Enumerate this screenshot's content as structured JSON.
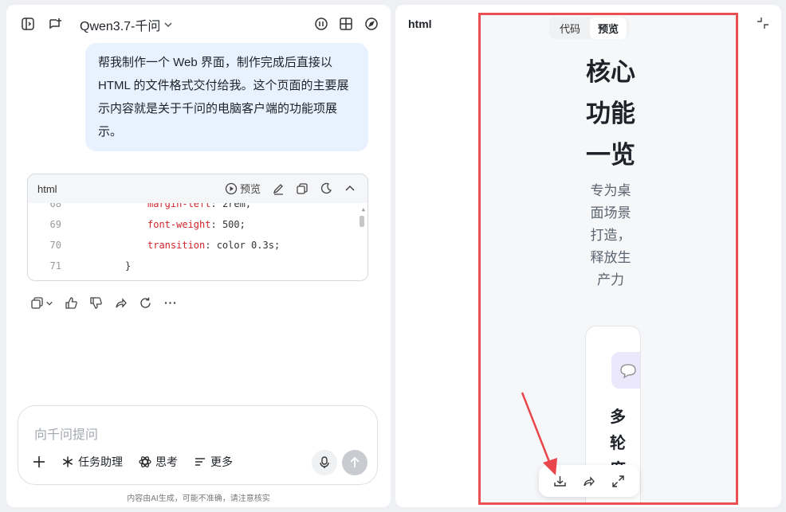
{
  "left": {
    "model_name": "Qwen3.7-千问",
    "user_message": "帮我制作一个 Web 界面，制作完成后直接以 HTML 的文件格式交付给我。这个页面的主要展示内容就是关于千问的电脑客户端的功能项展示。",
    "code_card": {
      "lang": "html",
      "preview_label": "预览",
      "lines": [
        {
          "num": "68",
          "prop": "margin-left",
          "val": "2rem;"
        },
        {
          "num": "69",
          "prop": "font-weight",
          "val": "500;"
        },
        {
          "num": "70",
          "prop": "transition",
          "val": "color 0.3s;"
        },
        {
          "num": "71",
          "brace": "}"
        }
      ]
    },
    "input": {
      "placeholder": "向千问提问",
      "tools": [
        "任务助理",
        "思考",
        "更多"
      ]
    },
    "footer_note": "内容由AI生成，可能不准确，请注意核实"
  },
  "right": {
    "title": "html",
    "tabs": [
      {
        "label": "代码",
        "active": false
      },
      {
        "label": "预览",
        "active": true
      }
    ],
    "preview": {
      "heading": "核心功能一览",
      "subtitle": "专为桌面场景打造，释放生产力",
      "card_title": "多轮度"
    },
    "highlight_color": "#ea4f52"
  }
}
